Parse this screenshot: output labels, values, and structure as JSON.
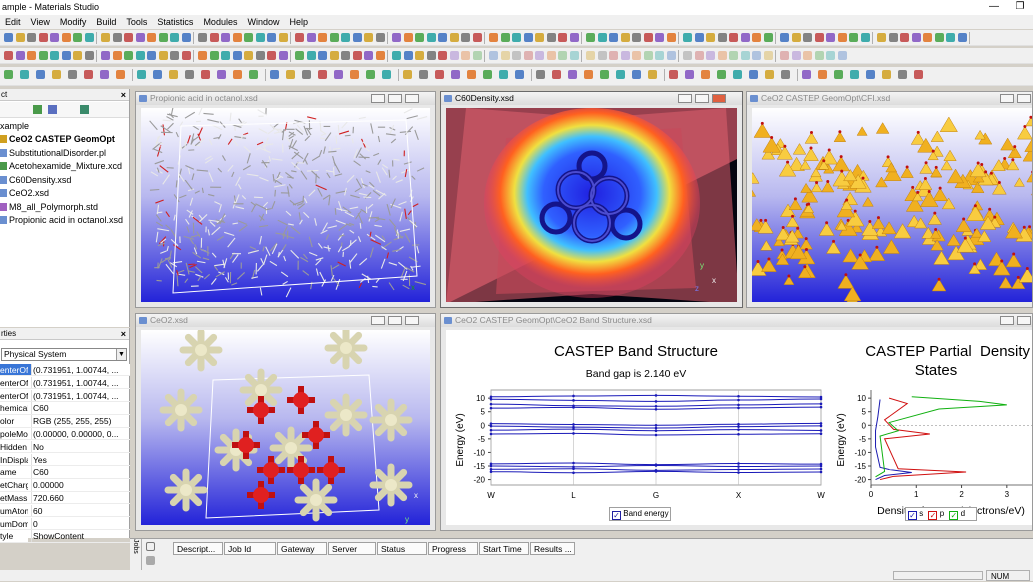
{
  "app": {
    "title": "ample - Materials Studio"
  },
  "menu": [
    "Edit",
    "View",
    "Modify",
    "Build",
    "Tools",
    "Statistics",
    "Modules",
    "Window",
    "Help"
  ],
  "project": {
    "header": "ct",
    "root": "xample",
    "items": [
      {
        "label": "CeO2 CASTEP GeomOpt",
        "bold": true
      },
      {
        "label": "SubstitutionalDisorder.pl"
      },
      {
        "label": "Acetohexamide_Mixture.xcd"
      },
      {
        "label": "C60Density.xsd"
      },
      {
        "label": "CeO2.xsd"
      },
      {
        "label": "M8_all_Polymorph.std"
      },
      {
        "label": "Propionic acid in octanol.xsd"
      }
    ]
  },
  "properties": {
    "header": "rties",
    "filter": "Physical System",
    "rows": [
      {
        "name": "enterOf",
        "value": "(0.731951, 1.00744, ..."
      },
      {
        "name": "enterOf",
        "value": "(0.731951, 1.00744, ..."
      },
      {
        "name": "enterOf",
        "value": "(0.731951, 1.00744, ..."
      },
      {
        "name": "hemicalF",
        "value": "C60"
      },
      {
        "name": "olor",
        "value": "RGB (255, 255, 255)"
      },
      {
        "name": "poleMor",
        "value": "(0.00000, 0.00000, 0..."
      },
      {
        "name": "Hidden",
        "value": "No"
      },
      {
        "name": "InDisplay",
        "value": "Yes"
      },
      {
        "name": "ame",
        "value": "C60"
      },
      {
        "name": "etCharg",
        "value": "0.00000"
      },
      {
        "name": "etMass",
        "value": "720.660"
      },
      {
        "name": "umAtom",
        "value": "60"
      },
      {
        "name": "umDomr",
        "value": "0"
      },
      {
        "name": "tyle",
        "value": "ShowContent"
      }
    ]
  },
  "windows": {
    "propionic": {
      "title": "Propionic acid in octanol.xsd"
    },
    "c60": {
      "title": "C60Density.xsd"
    },
    "cfi": {
      "title": "CeO2 CASTEP GeomOpt\\CFI.xsd"
    },
    "ceo2": {
      "title": "CeO2.xsd"
    },
    "band": {
      "title": "CeO2 CASTEP GeomOpt\\CeO2 Band Structure.xsd"
    }
  },
  "chart_data": [
    {
      "type": "line",
      "title": "CASTEP Band Structure",
      "subtitle": "Band gap is 2.140 eV",
      "ylabel": "Energy (eV)",
      "xlabel": "",
      "ylim": [
        -22,
        13
      ],
      "yticks": [
        10,
        5,
        0,
        -5,
        -10,
        -15,
        -20
      ],
      "xticks": [
        "W",
        "L",
        "G",
        "X",
        "W"
      ],
      "legend": [
        "Band energy"
      ],
      "legend_position": "bottom",
      "series": [
        {
          "values": [
            10.5,
            10.8,
            11.0,
            10.7,
            10.4
          ]
        },
        {
          "values": [
            9.6,
            9.2,
            8.8,
            9.3,
            9.7
          ]
        },
        {
          "values": [
            7.8,
            7.2,
            7.0,
            7.5,
            7.9
          ]
        },
        {
          "values": [
            6.3,
            6.6,
            5.9,
            6.4,
            6.7
          ]
        },
        {
          "values": [
            0.6,
            0.3,
            0.0,
            0.4,
            0.7
          ]
        },
        {
          "values": [
            -0.3,
            -0.7,
            -1.0,
            -0.5,
            -0.2
          ]
        },
        {
          "values": [
            -1.8,
            -1.4,
            -2.0,
            -1.6,
            -1.9
          ]
        },
        {
          "values": [
            -3.2,
            -3.0,
            -3.6,
            -3.3,
            -3.1
          ]
        },
        {
          "values": [
            -14.2,
            -13.9,
            -14.5,
            -14.1,
            -14.3
          ]
        },
        {
          "values": [
            -15.0,
            -15.3,
            -14.8,
            -15.2,
            -15.0
          ]
        },
        {
          "values": [
            -16.2,
            -16.0,
            -16.6,
            -16.3,
            -16.1
          ]
        },
        {
          "values": [
            -17.1,
            -17.5,
            -17.0,
            -17.4,
            -17.2
          ]
        }
      ]
    },
    {
      "type": "line",
      "title": "CASTEP Partial  Density of States",
      "xlabel": "Density of States (electrons/eV)",
      "ylabel": "Energy (eV)",
      "ylim": [
        -22,
        13
      ],
      "yticks": [
        10,
        5,
        0,
        -5,
        -10,
        -15,
        -20
      ],
      "xticks": [
        0,
        1,
        2,
        3
      ],
      "legend": [
        "s",
        "p",
        "d"
      ],
      "legend_position": "bottom",
      "series": [
        {
          "name": "s",
          "color": "#1a1ab0",
          "points": [
            [
              0.1,
              -20
            ],
            [
              0.3,
              -18.5
            ],
            [
              0.9,
              -17.4
            ],
            [
              0.4,
              -16.3
            ],
            [
              0.2,
              -15.5
            ],
            [
              0.1,
              -8
            ],
            [
              0.1,
              -2
            ],
            [
              0.15,
              3
            ],
            [
              0.2,
              9.5
            ]
          ]
        },
        {
          "name": "p",
          "color": "#d01010",
          "points": [
            [
              0.2,
              -20
            ],
            [
              0.5,
              -18.8
            ],
            [
              2.1,
              -17.2
            ],
            [
              0.6,
              -16
            ],
            [
              0.3,
              -5
            ],
            [
              1.3,
              -3.2
            ],
            [
              0.5,
              -1.5
            ],
            [
              0.3,
              2
            ],
            [
              0.8,
              8
            ],
            [
              0.4,
              10
            ]
          ]
        },
        {
          "name": "d",
          "color": "#10b010",
          "points": [
            [
              0.1,
              -19
            ],
            [
              0.3,
              -17
            ],
            [
              0.2,
              -4
            ],
            [
              0.6,
              -2
            ],
            [
              0.4,
              1
            ],
            [
              1.5,
              6
            ],
            [
              3.0,
              7.5
            ],
            [
              2.4,
              8.8
            ],
            [
              0.9,
              10.5
            ]
          ]
        }
      ]
    }
  ],
  "jobs": {
    "tab": "Jobs",
    "columns": [
      "Descript...",
      "Job Id",
      "Gateway",
      "Server",
      "Status",
      "Progress",
      "Start Time",
      "Results ..."
    ]
  },
  "status": {
    "num": "NUM"
  }
}
